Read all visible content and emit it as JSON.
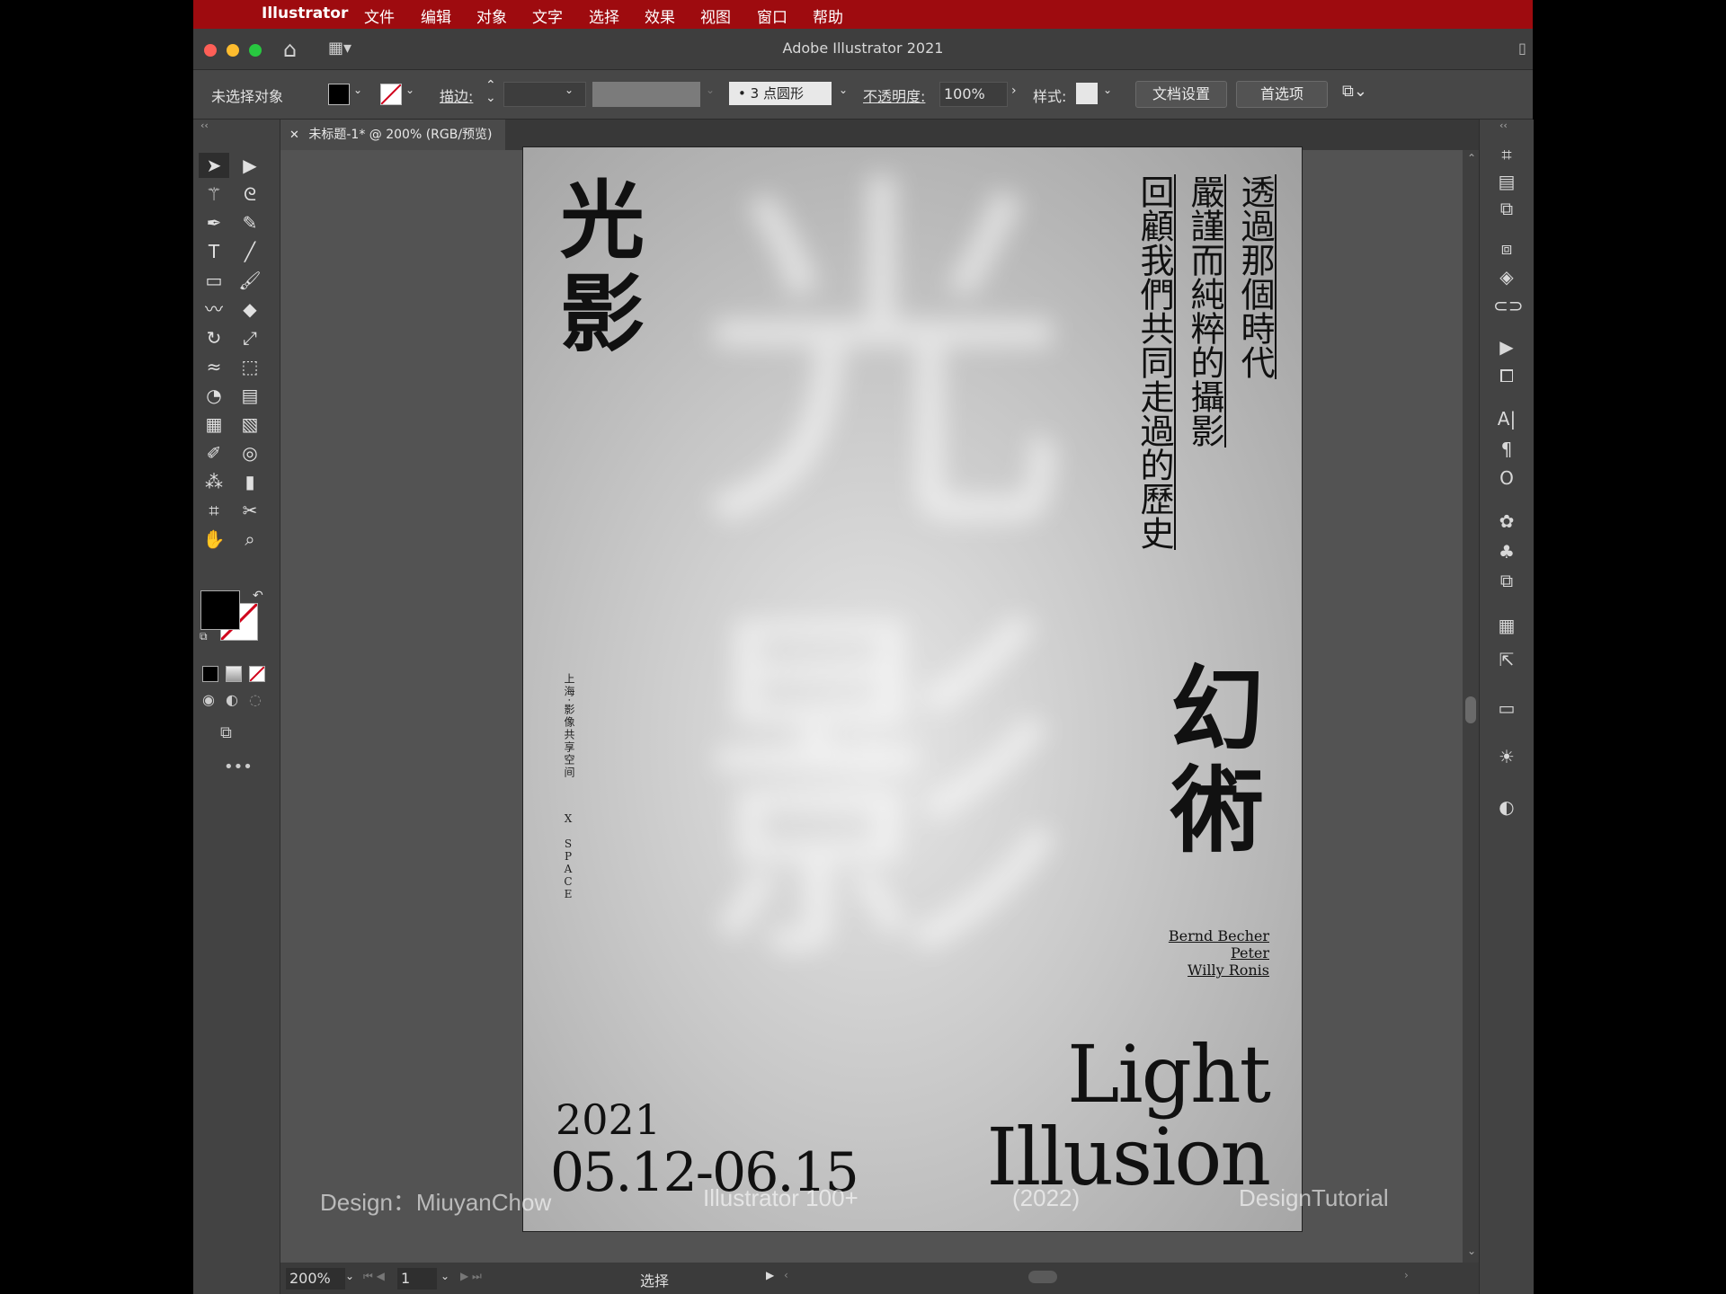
{
  "menubar": {
    "app_name": "Illustrator",
    "items": [
      "文件",
      "编辑",
      "对象",
      "文字",
      "选择",
      "效果",
      "视图",
      "窗口",
      "帮助"
    ]
  },
  "window": {
    "title": "Adobe Illustrator 2021"
  },
  "controlbar": {
    "selection_label": "未选择对象",
    "stroke_label": "描边:",
    "brush_label": "3 点圆形",
    "opacity_label": "不透明度:",
    "opacity_value": "100%",
    "style_label": "样式:",
    "doc_setup": "文档设置",
    "preferences": "首选项"
  },
  "document": {
    "tab_title": "未标题-1* @ 200% (RGB/预览)"
  },
  "poster": {
    "title_chars": [
      "光",
      "影"
    ],
    "vertical_col1": "透過那個時代",
    "vertical_col2": "嚴謹而純粹的攝影",
    "vertical_col3": "回顧我們共同走過的歷史",
    "venue": "上海·影像共享空间",
    "space": "X SPACE",
    "illusion_chars": [
      "幻",
      "術"
    ],
    "names": [
      "Bernd Becher",
      "Peter",
      "Willy Ronis"
    ],
    "year": "2021",
    "dates": "05.12-06.15",
    "english_line1": "Light",
    "english_line2": "Illusion"
  },
  "statusbar": {
    "zoom": "200%",
    "page": "1",
    "mode": "选择"
  },
  "watermark": {
    "designer": "Design：MiuyanChow",
    "series": "Illustrator 100+",
    "year": "(2022)",
    "brand": "DesignTutorial"
  },
  "colors": {
    "menubar": "#9e0b0f",
    "panel": "#434343",
    "canvas": "#535353"
  }
}
